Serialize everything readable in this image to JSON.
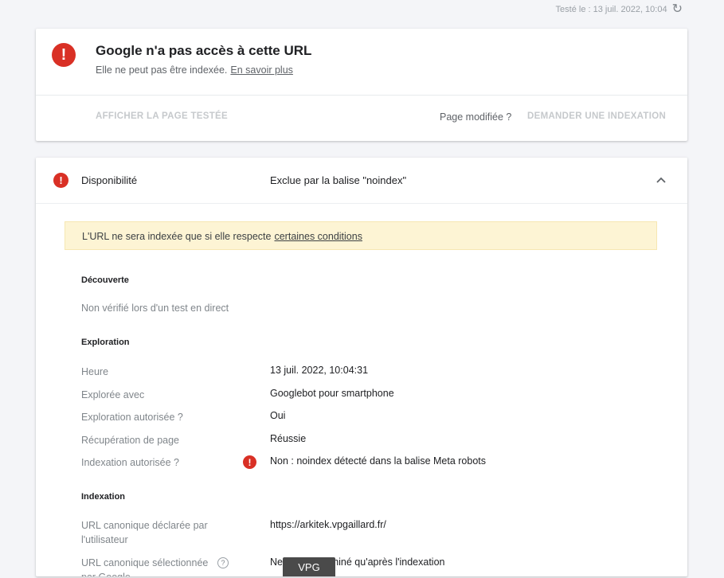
{
  "header_status": {
    "tested_text": "Testé le : 13 juil. 2022, 10:04",
    "refresh_icon": "refresh-icon"
  },
  "summary_card": {
    "title": "Google n'a pas accès à cette URL",
    "subtitle": "Elle ne peut pas être indexée.",
    "learn_more": "En savoir plus",
    "view_tested_page": "AFFICHER LA PAGE TESTÉE",
    "page_modified": "Page modifiée ?",
    "request_indexing": "DEMANDER UNE INDEXATION",
    "icon": "error-icon",
    "accent_color": "#d93025"
  },
  "availability": {
    "label": "Disponibilité",
    "status": "Exclue par la balise \"noindex\"",
    "icon": "error-icon",
    "expanded": true,
    "notice_prefix": "L'URL ne sera indexée que si elle respecte",
    "notice_link": "certaines conditions",
    "notice_color": "#fdf4d4"
  },
  "discovery": {
    "heading": "Découverte",
    "text": "Non vérifié lors d'un test en direct"
  },
  "crawl": {
    "heading": "Exploration",
    "rows": [
      {
        "label": "Heure",
        "value": "13 juil. 2022, 10:04:31",
        "error": false
      },
      {
        "label": "Explorée avec",
        "value": "Googlebot pour smartphone",
        "error": false
      },
      {
        "label": "Exploration autorisée ?",
        "value": "Oui",
        "error": false
      },
      {
        "label": "Récupération de page",
        "value": "Réussie",
        "error": false
      },
      {
        "label": "Indexation autorisée ?",
        "value": "Non : noindex détecté dans la balise Meta robots",
        "error": true
      }
    ]
  },
  "indexing": {
    "heading": "Indexation",
    "rows": [
      {
        "label": "URL canonique déclarée par l'utilisateur",
        "value": "https://arkitek.vpgaillard.fr/"
      },
      {
        "label": "URL canonique sélectionnée par Google",
        "value": "Ne sera déterminé qu'après l'indexation"
      }
    ]
  },
  "watermark": "VPG"
}
